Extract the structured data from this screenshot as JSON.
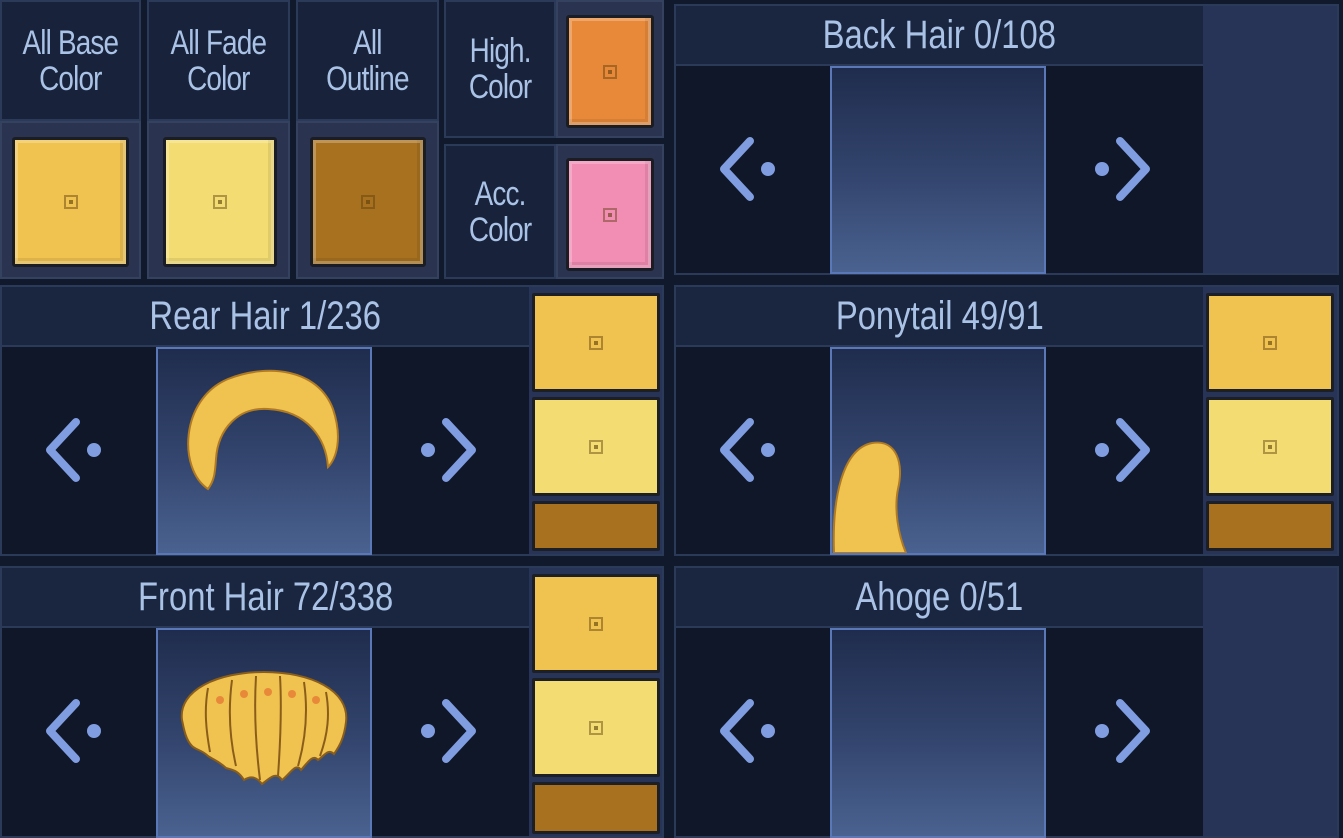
{
  "colors": {
    "base": "#f0c24f",
    "fade": "#f3dd72",
    "outline": "#a8711f",
    "high": "#e8893a",
    "acc": "#f28db4",
    "arrow": "#7f9de0"
  },
  "top_left": {
    "all_base": "All Base\nColor",
    "all_fade": "All Fade\nColor",
    "all_outline": "All\nOutline",
    "high_color": "High.\nColor",
    "acc_color": "Acc.\nColor"
  },
  "panels": {
    "back_hair": {
      "title": "Back Hair 0/108",
      "icon": "back-hair-preview"
    },
    "rear_hair": {
      "title": "Rear Hair 1/236",
      "icon": "rear-hair-preview"
    },
    "ponytail": {
      "title": "Ponytail 49/91",
      "icon": "ponytail-preview"
    },
    "front_hair": {
      "title": "Front Hair 72/338",
      "icon": "front-hair-preview"
    },
    "ahoge": {
      "title": "Ahoge 0/51",
      "icon": "ahoge-preview"
    }
  },
  "icons": {
    "prev": "chevron-left-icon",
    "next": "chevron-right-icon"
  }
}
